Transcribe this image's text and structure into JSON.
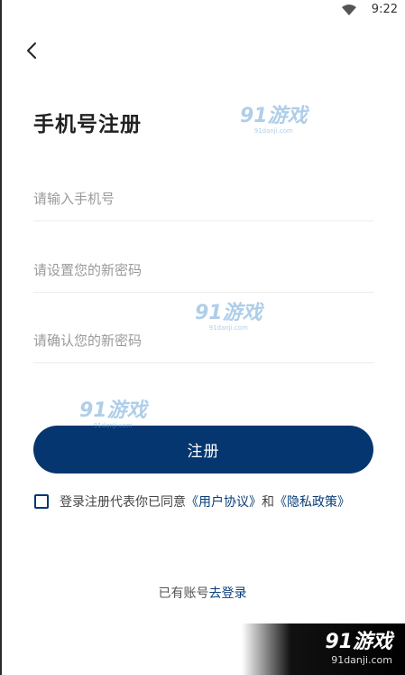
{
  "status_bar": {
    "time": "9:22",
    "wifi_icon": "wifi-icon"
  },
  "nav": {
    "back_icon": "back-arrow-icon"
  },
  "title": "手机号注册",
  "form": {
    "phone_placeholder": "请输入手机号",
    "password_placeholder": "请设置您的新密码",
    "confirm_placeholder": "请确认您的新密码"
  },
  "register_button": "注册",
  "agreement": {
    "prefix": "登录注册代表你已同意",
    "user_agreement": "《用户协议》",
    "and": "和",
    "privacy_policy": "《隐私政策》",
    "checked": false
  },
  "login": {
    "prefix": "已有账号",
    "link": "去登录"
  },
  "watermarks": {
    "logo": "91游戏",
    "url": "91danji.com"
  },
  "colors": {
    "primary": "#053670",
    "link": "#0a3e79",
    "watermark": "#6ea7d8"
  }
}
